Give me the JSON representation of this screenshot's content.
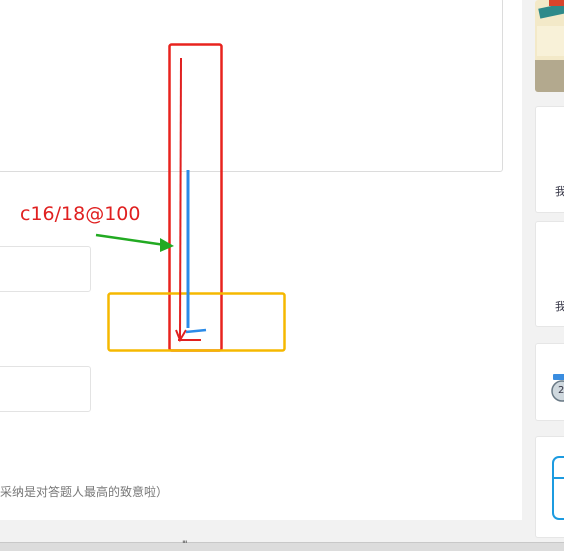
{
  "annotation": {
    "label": "c16/18@100"
  },
  "form": {
    "hint_text": "采纳是对答题人最高的致意啦）"
  },
  "sidebar": {
    "cards": [
      {
        "text": "我"
      },
      {
        "text": "我"
      }
    ],
    "badge_glyph": "2"
  },
  "bottom_bar": {
    "grip": "'''"
  },
  "colors": {
    "annotation_red": "#e8231e",
    "annotation_orange": "#f5b800",
    "annotation_green": "#22aa22",
    "annotation_blue": "#2b8be8",
    "page_bg": "#f2f2f2"
  }
}
